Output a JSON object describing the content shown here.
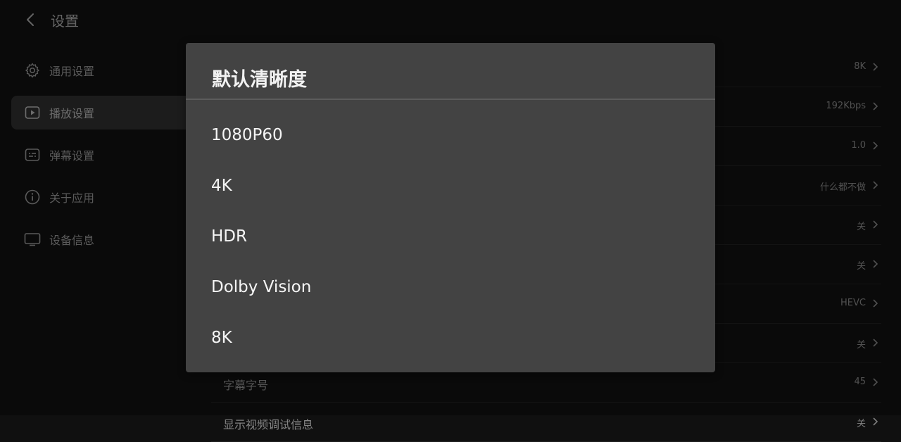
{
  "header": {
    "title": "设置"
  },
  "sidebar": {
    "items": [
      {
        "label": "通用设置",
        "icon": "gear-icon"
      },
      {
        "label": "播放设置",
        "icon": "play-icon",
        "active": true
      },
      {
        "label": "弹幕设置",
        "icon": "danmaku-icon"
      },
      {
        "label": "关于应用",
        "icon": "info-icon"
      },
      {
        "label": "设备信息",
        "icon": "tv-icon"
      }
    ]
  },
  "settings": {
    "rows": [
      {
        "label": "",
        "value": "8K"
      },
      {
        "label": "",
        "value": "192Kbps"
      },
      {
        "label": "",
        "value": "1.0"
      },
      {
        "label": "",
        "value": "什么都不做"
      },
      {
        "label": "",
        "value": "关"
      },
      {
        "label": "",
        "value": "关"
      },
      {
        "label": "",
        "value": "HEVC"
      },
      {
        "label": "",
        "value": "关"
      },
      {
        "label": "字幕字号",
        "value": "45"
      },
      {
        "label": "显示视频调试信息",
        "value": "关"
      }
    ]
  },
  "dialog": {
    "title": "默认清晰度",
    "options": [
      "1080P60",
      "4K",
      "HDR",
      "Dolby Vision",
      "8K"
    ]
  },
  "colors": {
    "background": "#101010",
    "dialog": "#434343",
    "active_nav": "#2c2c2c"
  }
}
